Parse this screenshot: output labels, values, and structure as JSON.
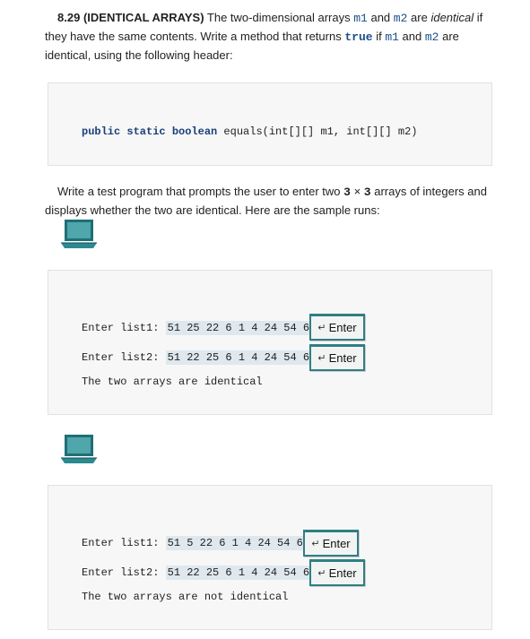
{
  "problem": {
    "number": "8.29",
    "title": "(IDENTICAL ARRAYS)",
    "text_1": "The two-dimensional arrays",
    "m1": "m1",
    "and": "and",
    "m2": "m2",
    "are": "are",
    "identical": "identical",
    "text_2": "if they have the same contents. Write a method that returns",
    "true_kw": "true",
    "if_word": "if",
    "and2": "and",
    "text_3": "are identical, using the following header:"
  },
  "code": {
    "header_modifiers": "public static boolean",
    "header_rest": " equals(int[][] m1, int[][] m2)"
  },
  "para2": {
    "text_a": "Write a test program that prompts the user to enter two",
    "dim_a": "3",
    "times": "×",
    "dim_b": "3",
    "text_b": "arrays of integers and displays whether the two are identical. Here are the sample runs:"
  },
  "icons": {
    "laptop": "laptop-icon",
    "enter": "enter-arrow-icon"
  },
  "runs": [
    {
      "prompt1": "Enter list1: ",
      "input1": "51 25 22 6 1 4 24 54 6",
      "prompt2": "Enter list2: ",
      "input2": "51 22 25 6 1 4 24 54 6",
      "result": "The two arrays are identical",
      "enter_label": "Enter"
    },
    {
      "prompt1": "Enter list1: ",
      "input1": "51 5 22 6 1 4 24 54 6",
      "prompt2": "Enter list2: ",
      "input2": "51 22 25 6 1 4 24 54 6",
      "result": "The two arrays are not identical",
      "enter_label": "Enter"
    }
  ]
}
